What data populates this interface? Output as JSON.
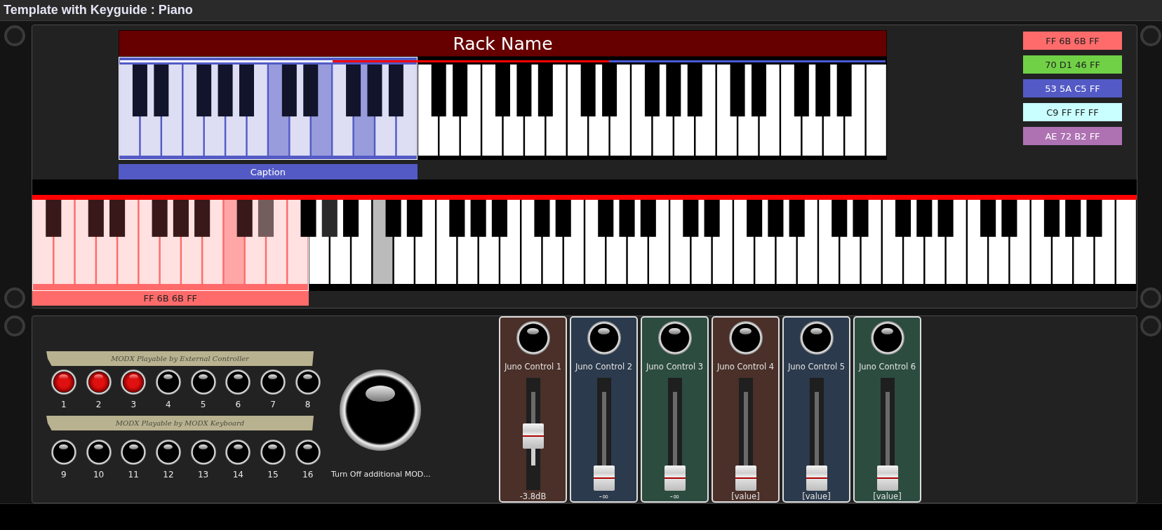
{
  "window": {
    "title": "Template with Keyguide : Piano"
  },
  "keyboards": [
    {
      "title": "Rack Name",
      "zone": {
        "label": "Caption",
        "color": "#535ac5"
      },
      "segments": [
        {
          "color": "#ffffff",
          "keys": [
            {
              "kind": "white",
              "in_zone": true,
              "pressed": false
            },
            {
              "kind": "black",
              "in_zone": true,
              "pressed": false
            },
            {
              "kind": "white",
              "in_zone": true,
              "pressed": false
            },
            {
              "kind": "black",
              "in_zone": true,
              "pressed": false
            },
            {
              "kind": "white",
              "in_zone": true,
              "pressed": false
            },
            {
              "kind": "white",
              "in_zone": true,
              "pressed": false
            },
            {
              "kind": "black",
              "in_zone": true,
              "pressed": false
            },
            {
              "kind": "white",
              "in_zone": true,
              "pressed": false
            },
            {
              "kind": "black",
              "in_zone": true,
              "pressed": false
            },
            {
              "kind": "white",
              "in_zone": true,
              "pressed": false
            },
            {
              "kind": "black",
              "in_zone": true,
              "pressed": false
            },
            {
              "kind": "white",
              "in_zone": true,
              "pressed": false
            },
            {
              "kind": "white",
              "in_zone": true,
              "pressed": true
            },
            {
              "kind": "black",
              "in_zone": true,
              "pressed": false
            },
            {
              "kind": "white",
              "in_zone": true,
              "pressed": false
            },
            {
              "kind": "black",
              "in_zone": true,
              "pressed": false
            },
            {
              "kind": "white",
              "in_zone": true,
              "pressed": true
            }
          ]
        },
        {
          "color": "#ff0000",
          "keys": [
            {
              "kind": "white",
              "in_zone": true,
              "pressed": false
            },
            {
              "kind": "black",
              "in_zone": true,
              "pressed": false
            },
            {
              "kind": "white",
              "in_zone": true,
              "pressed": true
            },
            {
              "kind": "black",
              "in_zone": true,
              "pressed": false
            },
            {
              "kind": "white",
              "in_zone": true,
              "pressed": false
            },
            {
              "kind": "black",
              "in_zone": true,
              "pressed": false
            },
            {
              "kind": "white",
              "in_zone": true,
              "pressed": false
            },
            {
              "kind": "white",
              "in_zone": false,
              "pressed": false
            },
            {
              "kind": "black",
              "in_zone": false,
              "pressed": false
            },
            {
              "kind": "white",
              "in_zone": false,
              "pressed": false
            },
            {
              "kind": "black",
              "in_zone": false,
              "pressed": false
            },
            {
              "kind": "white",
              "in_zone": false,
              "pressed": false
            },
            {
              "kind": "white",
              "in_zone": false,
              "pressed": false
            },
            {
              "kind": "black",
              "in_zone": false,
              "pressed": false
            },
            {
              "kind": "white",
              "in_zone": false,
              "pressed": false
            },
            {
              "kind": "black",
              "in_zone": false,
              "pressed": false
            },
            {
              "kind": "white",
              "in_zone": false,
              "pressed": false
            },
            {
              "kind": "black",
              "in_zone": false,
              "pressed": false
            },
            {
              "kind": "white",
              "in_zone": false,
              "pressed": false
            },
            {
              "kind": "white",
              "in_zone": false,
              "pressed": false
            },
            {
              "kind": "black",
              "in_zone": false,
              "pressed": false
            },
            {
              "kind": "white",
              "in_zone": false,
              "pressed": false
            }
          ]
        },
        {
          "color": "#4a5ad8",
          "keys": [
            {
              "kind": "black",
              "in_zone": false,
              "pressed": false
            },
            {
              "kind": "white",
              "in_zone": false,
              "pressed": false
            },
            {
              "kind": "white",
              "in_zone": false,
              "pressed": false
            },
            {
              "kind": "black",
              "in_zone": false,
              "pressed": false
            },
            {
              "kind": "white",
              "in_zone": false,
              "pressed": false
            },
            {
              "kind": "black",
              "in_zone": false,
              "pressed": false
            },
            {
              "kind": "white",
              "in_zone": false,
              "pressed": false
            },
            {
              "kind": "black",
              "in_zone": false,
              "pressed": false
            },
            {
              "kind": "white",
              "in_zone": false,
              "pressed": false
            },
            {
              "kind": "white",
              "in_zone": false,
              "pressed": false
            },
            {
              "kind": "black",
              "in_zone": false,
              "pressed": false
            },
            {
              "kind": "white",
              "in_zone": false,
              "pressed": false
            },
            {
              "kind": "black",
              "in_zone": false,
              "pressed": false
            },
            {
              "kind": "white",
              "in_zone": false,
              "pressed": false
            },
            {
              "kind": "white",
              "in_zone": false,
              "pressed": false
            },
            {
              "kind": "black",
              "in_zone": false,
              "pressed": false
            },
            {
              "kind": "white",
              "in_zone": false,
              "pressed": false
            },
            {
              "kind": "black",
              "in_zone": false,
              "pressed": false
            },
            {
              "kind": "white",
              "in_zone": false,
              "pressed": false
            },
            {
              "kind": "black",
              "in_zone": false,
              "pressed": false
            },
            {
              "kind": "white",
              "in_zone": false,
              "pressed": false
            },
            {
              "kind": "white",
              "in_zone": false,
              "pressed": false
            }
          ]
        }
      ]
    },
    {
      "zone": {
        "label": "FF 6B 6B FF",
        "color": "#ff6b6b"
      },
      "segments": [
        {
          "color": "#ff0000",
          "keys": [
            {
              "kind": "white",
              "in_zone": true,
              "pressed": false
            },
            {
              "kind": "black",
              "in_zone": true,
              "pressed": false
            },
            {
              "kind": "white",
              "in_zone": true,
              "pressed": false
            },
            {
              "kind": "white",
              "in_zone": true,
              "pressed": false
            },
            {
              "kind": "black",
              "in_zone": true,
              "pressed": false
            },
            {
              "kind": "white",
              "in_zone": true,
              "pressed": false
            },
            {
              "kind": "black",
              "in_zone": true,
              "pressed": false
            },
            {
              "kind": "white",
              "in_zone": true,
              "pressed": false
            },
            {
              "kind": "white",
              "in_zone": true,
              "pressed": false
            },
            {
              "kind": "black",
              "in_zone": true,
              "pressed": false
            },
            {
              "kind": "white",
              "in_zone": true,
              "pressed": false
            },
            {
              "kind": "black",
              "in_zone": true,
              "pressed": false
            },
            {
              "kind": "white",
              "in_zone": true,
              "pressed": false
            },
            {
              "kind": "black",
              "in_zone": true,
              "pressed": false
            },
            {
              "kind": "white",
              "in_zone": true,
              "pressed": false
            },
            {
              "kind": "white",
              "in_zone": true,
              "pressed": true
            },
            {
              "kind": "black",
              "in_zone": true,
              "pressed": false
            },
            {
              "kind": "white",
              "in_zone": true,
              "pressed": false
            },
            {
              "kind": "black",
              "in_zone": true,
              "pressed": true
            },
            {
              "kind": "white",
              "in_zone": true,
              "pressed": false
            },
            {
              "kind": "white",
              "in_zone": true,
              "pressed": false
            },
            {
              "kind": "black",
              "in_zone": false,
              "pressed": false
            },
            {
              "kind": "white",
              "in_zone": false,
              "pressed": false
            },
            {
              "kind": "black",
              "in_zone": false,
              "pressed": true
            },
            {
              "kind": "white",
              "in_zone": false,
              "pressed": false
            },
            {
              "kind": "black",
              "in_zone": false,
              "pressed": false
            },
            {
              "kind": "white",
              "in_zone": false,
              "pressed": false
            },
            {
              "kind": "white",
              "in_zone": false,
              "pressed": true
            },
            {
              "kind": "black",
              "in_zone": false,
              "pressed": false
            },
            {
              "kind": "white",
              "in_zone": false,
              "pressed": false
            },
            {
              "kind": "black",
              "in_zone": false,
              "pressed": false
            },
            {
              "kind": "white",
              "in_zone": false,
              "pressed": false
            },
            {
              "kind": "white",
              "in_zone": false,
              "pressed": false
            },
            {
              "kind": "black",
              "in_zone": false,
              "pressed": false
            },
            {
              "kind": "white",
              "in_zone": false,
              "pressed": false
            },
            {
              "kind": "black",
              "in_zone": false,
              "pressed": false
            },
            {
              "kind": "white",
              "in_zone": false,
              "pressed": false
            },
            {
              "kind": "black",
              "in_zone": false,
              "pressed": false
            },
            {
              "kind": "white",
              "in_zone": false,
              "pressed": false
            },
            {
              "kind": "white",
              "in_zone": false,
              "pressed": false
            },
            {
              "kind": "black",
              "in_zone": false,
              "pressed": false
            },
            {
              "kind": "white",
              "in_zone": false,
              "pressed": false
            },
            {
              "kind": "black",
              "in_zone": false,
              "pressed": false
            },
            {
              "kind": "white",
              "in_zone": false,
              "pressed": false
            },
            {
              "kind": "white",
              "in_zone": false,
              "pressed": false
            },
            {
              "kind": "black",
              "in_zone": false,
              "pressed": false
            },
            {
              "kind": "white",
              "in_zone": false,
              "pressed": false
            },
            {
              "kind": "black",
              "in_zone": false,
              "pressed": false
            },
            {
              "kind": "white",
              "in_zone": false,
              "pressed": false
            },
            {
              "kind": "black",
              "in_zone": false,
              "pressed": false
            },
            {
              "kind": "white",
              "in_zone": false,
              "pressed": false
            },
            {
              "kind": "white",
              "in_zone": false,
              "pressed": false
            },
            {
              "kind": "black",
              "in_zone": false,
              "pressed": false
            },
            {
              "kind": "white",
              "in_zone": false,
              "pressed": false
            },
            {
              "kind": "black",
              "in_zone": false,
              "pressed": false
            },
            {
              "kind": "white",
              "in_zone": false,
              "pressed": false
            },
            {
              "kind": "white",
              "in_zone": false,
              "pressed": false
            },
            {
              "kind": "black",
              "in_zone": false,
              "pressed": false
            },
            {
              "kind": "white",
              "in_zone": false,
              "pressed": false
            },
            {
              "kind": "black",
              "in_zone": false,
              "pressed": false
            },
            {
              "kind": "white",
              "in_zone": false,
              "pressed": false
            },
            {
              "kind": "black",
              "in_zone": false,
              "pressed": false
            },
            {
              "kind": "white",
              "in_zone": false,
              "pressed": false
            },
            {
              "kind": "white",
              "in_zone": false,
              "pressed": false
            },
            {
              "kind": "black",
              "in_zone": false,
              "pressed": false
            },
            {
              "kind": "white",
              "in_zone": false,
              "pressed": false
            },
            {
              "kind": "black",
              "in_zone": false,
              "pressed": false
            },
            {
              "kind": "white",
              "in_zone": false,
              "pressed": false
            },
            {
              "kind": "white",
              "in_zone": false,
              "pressed": false
            },
            {
              "kind": "black",
              "in_zone": false,
              "pressed": false
            },
            {
              "kind": "white",
              "in_zone": false,
              "pressed": false
            },
            {
              "kind": "black",
              "in_zone": false,
              "pressed": false
            },
            {
              "kind": "white",
              "in_zone": false,
              "pressed": false
            },
            {
              "kind": "black",
              "in_zone": false,
              "pressed": false
            },
            {
              "kind": "white",
              "in_zone": false,
              "pressed": false
            },
            {
              "kind": "white",
              "in_zone": false,
              "pressed": false
            },
            {
              "kind": "black",
              "in_zone": false,
              "pressed": false
            },
            {
              "kind": "white",
              "in_zone": false,
              "pressed": false
            },
            {
              "kind": "black",
              "in_zone": false,
              "pressed": false
            },
            {
              "kind": "white",
              "in_zone": false,
              "pressed": false
            },
            {
              "kind": "white",
              "in_zone": false,
              "pressed": false
            },
            {
              "kind": "black",
              "in_zone": false,
              "pressed": false
            },
            {
              "kind": "white",
              "in_zone": false,
              "pressed": false
            },
            {
              "kind": "black",
              "in_zone": false,
              "pressed": false
            },
            {
              "kind": "white",
              "in_zone": false,
              "pressed": false
            },
            {
              "kind": "black",
              "in_zone": false,
              "pressed": false
            },
            {
              "kind": "white",
              "in_zone": false,
              "pressed": false
            },
            {
              "kind": "white",
              "in_zone": false,
              "pressed": false
            }
          ]
        }
      ]
    }
  ],
  "swatches": [
    {
      "label": "FF 6B 6B FF",
      "color": "#ff6b6b"
    },
    {
      "label": "70 D1 46 FF",
      "color": "#70d146"
    },
    {
      "label": "53 5A C5 FF",
      "color": "#535ac5"
    },
    {
      "label": "C9 FF FF FF",
      "color": "#c9ffff"
    },
    {
      "label": "AE 72 B2 FF",
      "color": "#ae72b2"
    }
  ],
  "modx": {
    "groups": [
      {
        "banner": "MODX Playable by External Controller",
        "buttons": [
          {
            "label": "1",
            "on": true
          },
          {
            "label": "2",
            "on": true
          },
          {
            "label": "3",
            "on": true
          },
          {
            "label": "4",
            "on": false
          },
          {
            "label": "5",
            "on": false
          },
          {
            "label": "6",
            "on": false
          },
          {
            "label": "7",
            "on": false
          },
          {
            "label": "8",
            "on": false
          }
        ]
      },
      {
        "banner": "MODX Playable by MODX Keyboard",
        "buttons": [
          {
            "label": "9",
            "on": false
          },
          {
            "label": "10",
            "on": false
          },
          {
            "label": "11",
            "on": false
          },
          {
            "label": "12",
            "on": false
          },
          {
            "label": "13",
            "on": false
          },
          {
            "label": "14",
            "on": false
          },
          {
            "label": "15",
            "on": false
          },
          {
            "label": "16",
            "on": false
          }
        ]
      }
    ],
    "big_button": {
      "label": "Turn Off additional MOD..."
    }
  },
  "channels": [
    {
      "name": "Juno Control 1",
      "color": "#4a3029",
      "level": 0.57,
      "reading": "-3.8dB"
    },
    {
      "name": "Juno Control 2",
      "color": "#2b3a4c",
      "level": 0,
      "reading": "-∞"
    },
    {
      "name": "Juno Control 3",
      "color": "#2c4c40",
      "level": 0,
      "reading": "-∞"
    },
    {
      "name": "Juno Control 4",
      "color": "#4a3029",
      "level": 0,
      "reading": "[value]"
    },
    {
      "name": "Juno Control 5",
      "color": "#2b3a4c",
      "level": 0,
      "reading": "[value]"
    },
    {
      "name": "Juno Control 6",
      "color": "#2c4c40",
      "level": 0,
      "reading": "[value]"
    }
  ]
}
